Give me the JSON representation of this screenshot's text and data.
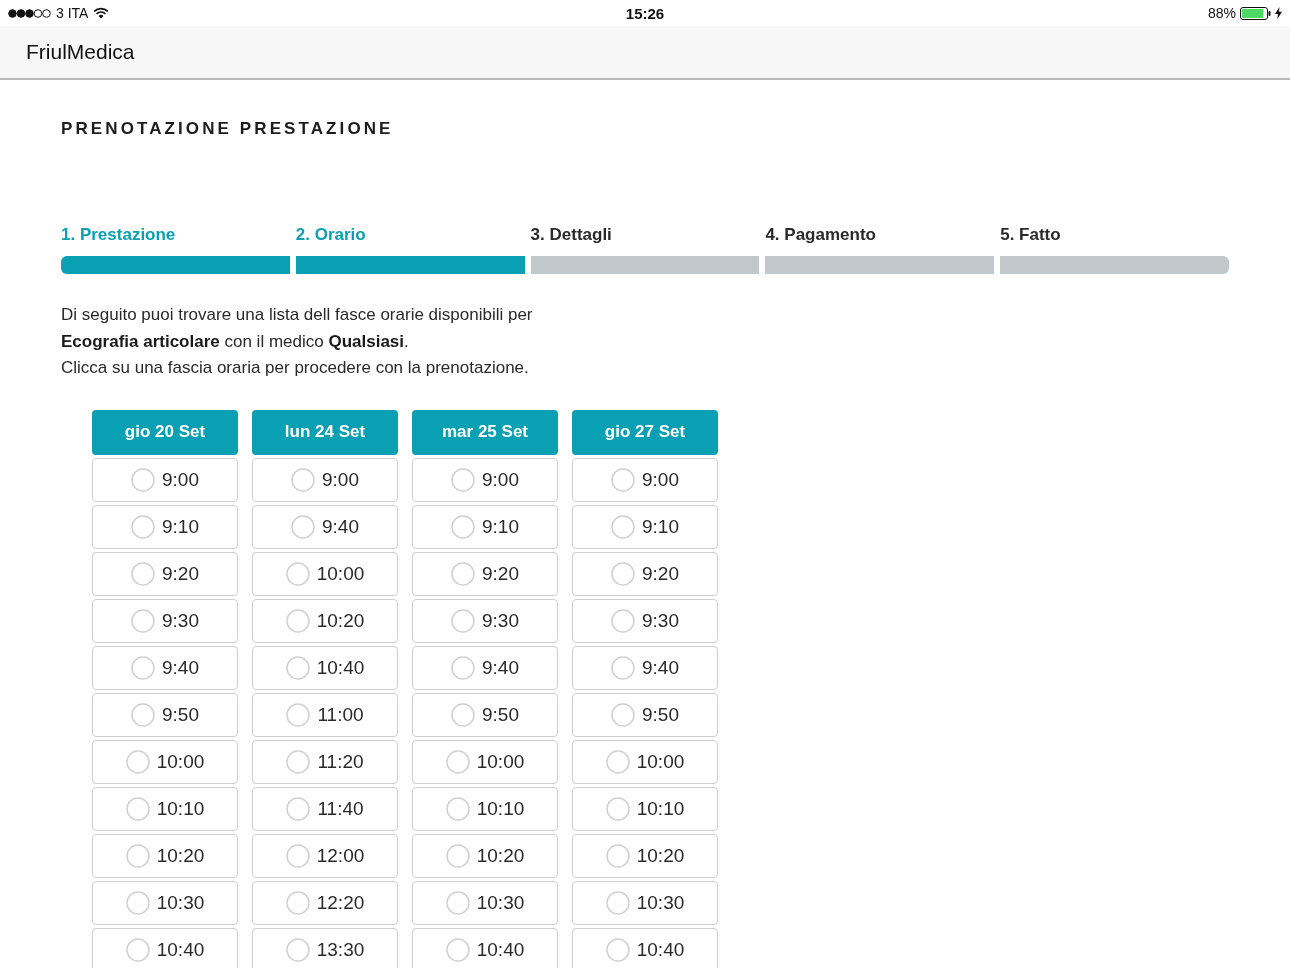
{
  "status_bar": {
    "carrier": "3 ITA",
    "time": "15:26",
    "battery": "88%"
  },
  "nav_bar": {
    "title": "FriulMedica"
  },
  "page_title": "PRENOTAZIONE PRESTAZIONE",
  "steps": [
    {
      "label": "1. Prestazione",
      "active": true
    },
    {
      "label": "2. Orario",
      "active": true
    },
    {
      "label": "3. Dettagli",
      "active": false
    },
    {
      "label": "4. Pagamento",
      "active": false
    },
    {
      "label": "5. Fatto",
      "active": false
    }
  ],
  "intro": {
    "lines": [
      "Di seguito puoi trovare una lista dell fasce orarie disponibili per",
      "**Ecografia articolare** con il medico **Qualsiasi**.",
      "Clicca su una fascia oraria per procedere con la prenotazione."
    ]
  },
  "schedule": {
    "days": [
      {
        "label": "gio 20 Set",
        "slots": [
          {
            "time": "9:00",
            "selected": false
          },
          {
            "time": "9:10",
            "selected": false
          },
          {
            "time": "9:20",
            "selected": false
          },
          {
            "time": "9:30",
            "selected": false
          },
          {
            "time": "9:40",
            "selected": false
          },
          {
            "time": "9:50",
            "selected": false
          },
          {
            "time": "10:00",
            "selected": false
          },
          {
            "time": "10:10",
            "selected": false
          },
          {
            "time": "10:20",
            "selected": false
          },
          {
            "time": "10:30",
            "selected": false
          },
          {
            "time": "10:40",
            "selected": false
          }
        ]
      },
      {
        "label": "lun 24 Set",
        "slots": [
          {
            "time": "9:00",
            "selected": false
          },
          {
            "time": "9:40",
            "selected": false
          },
          {
            "time": "10:00",
            "selected": false
          },
          {
            "time": "10:20",
            "selected": false
          },
          {
            "time": "10:40",
            "selected": false
          },
          {
            "time": "11:00",
            "selected": false
          },
          {
            "time": "11:20",
            "selected": false
          },
          {
            "time": "11:40",
            "selected": false
          },
          {
            "time": "12:00",
            "selected": false
          },
          {
            "time": "12:20",
            "selected": false
          },
          {
            "time": "13:30",
            "selected": false
          }
        ]
      },
      {
        "label": "mar 25 Set",
        "slots": [
          {
            "time": "9:00",
            "selected": false
          },
          {
            "time": "9:10",
            "selected": false
          },
          {
            "time": "9:20",
            "selected": false
          },
          {
            "time": "9:30",
            "selected": false
          },
          {
            "time": "9:40",
            "selected": false
          },
          {
            "time": "9:50",
            "selected": false
          },
          {
            "time": "10:00",
            "selected": false
          },
          {
            "time": "10:10",
            "selected": false
          },
          {
            "time": "10:20",
            "selected": false
          },
          {
            "time": "10:30",
            "selected": false
          },
          {
            "time": "10:40",
            "selected": false
          }
        ]
      },
      {
        "label": "gio 27 Set",
        "slots": [
          {
            "time": "9:00",
            "selected": false
          },
          {
            "time": "9:10",
            "selected": false
          },
          {
            "time": "9:20",
            "selected": false
          },
          {
            "time": "9:30",
            "selected": false
          },
          {
            "time": "9:40",
            "selected": false
          },
          {
            "time": "9:50",
            "selected": false
          },
          {
            "time": "10:00",
            "selected": false
          },
          {
            "time": "10:10",
            "selected": false
          },
          {
            "time": "10:20",
            "selected": false
          },
          {
            "time": "10:30",
            "selected": false
          },
          {
            "time": "10:40",
            "selected": false
          }
        ]
      }
    ]
  }
}
